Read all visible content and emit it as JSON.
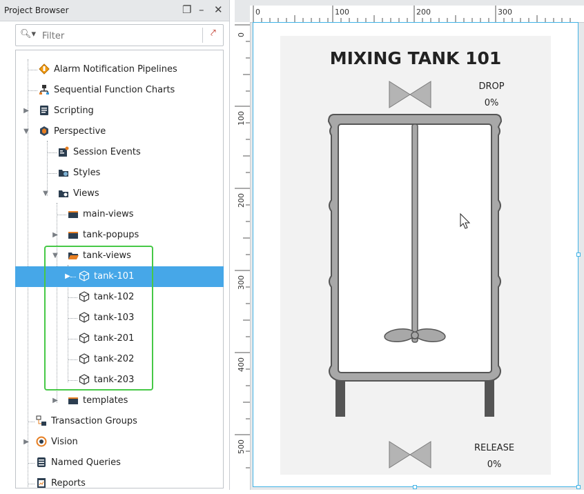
{
  "panel": {
    "title": "Project Browser",
    "window_controls": [
      "restore-icon",
      "minimize-icon",
      "close-icon"
    ]
  },
  "filter": {
    "placeholder": "Filter"
  },
  "tree": {
    "alarm": "Alarm Notification Pipelines",
    "sfc": "Sequential Function Charts",
    "scripting": "Scripting",
    "perspective": "Perspective",
    "session_events": "Session Events",
    "styles": "Styles",
    "views": "Views",
    "main_views": "main-views",
    "tank_popups": "tank-popups",
    "tank_views": "tank-views",
    "tank_101": "tank-101",
    "tank_102": "tank-102",
    "tank_103": "tank-103",
    "tank_201": "tank-201",
    "tank_202": "tank-202",
    "tank_203": "tank-203",
    "templates": "templates",
    "transaction_groups": "Transaction Groups",
    "vision": "Vision",
    "named_queries": "Named Queries",
    "reports": "Reports"
  },
  "ruler": {
    "h_labels": [
      "0",
      "100",
      "200",
      "300"
    ],
    "v_labels": [
      "0",
      "100",
      "200",
      "300",
      "400",
      "500"
    ]
  },
  "view": {
    "title": "MIXING TANK 101",
    "drop_label": "DROP",
    "drop_value": "0%",
    "release_label": "RELEASE",
    "release_value": "0%"
  },
  "colors": {
    "selection": "#46a7e8",
    "highlight_box": "#46c846",
    "page_border": "#3fb2e6",
    "tank_fill": "#a8a8a8",
    "tank_outline": "#555555"
  }
}
